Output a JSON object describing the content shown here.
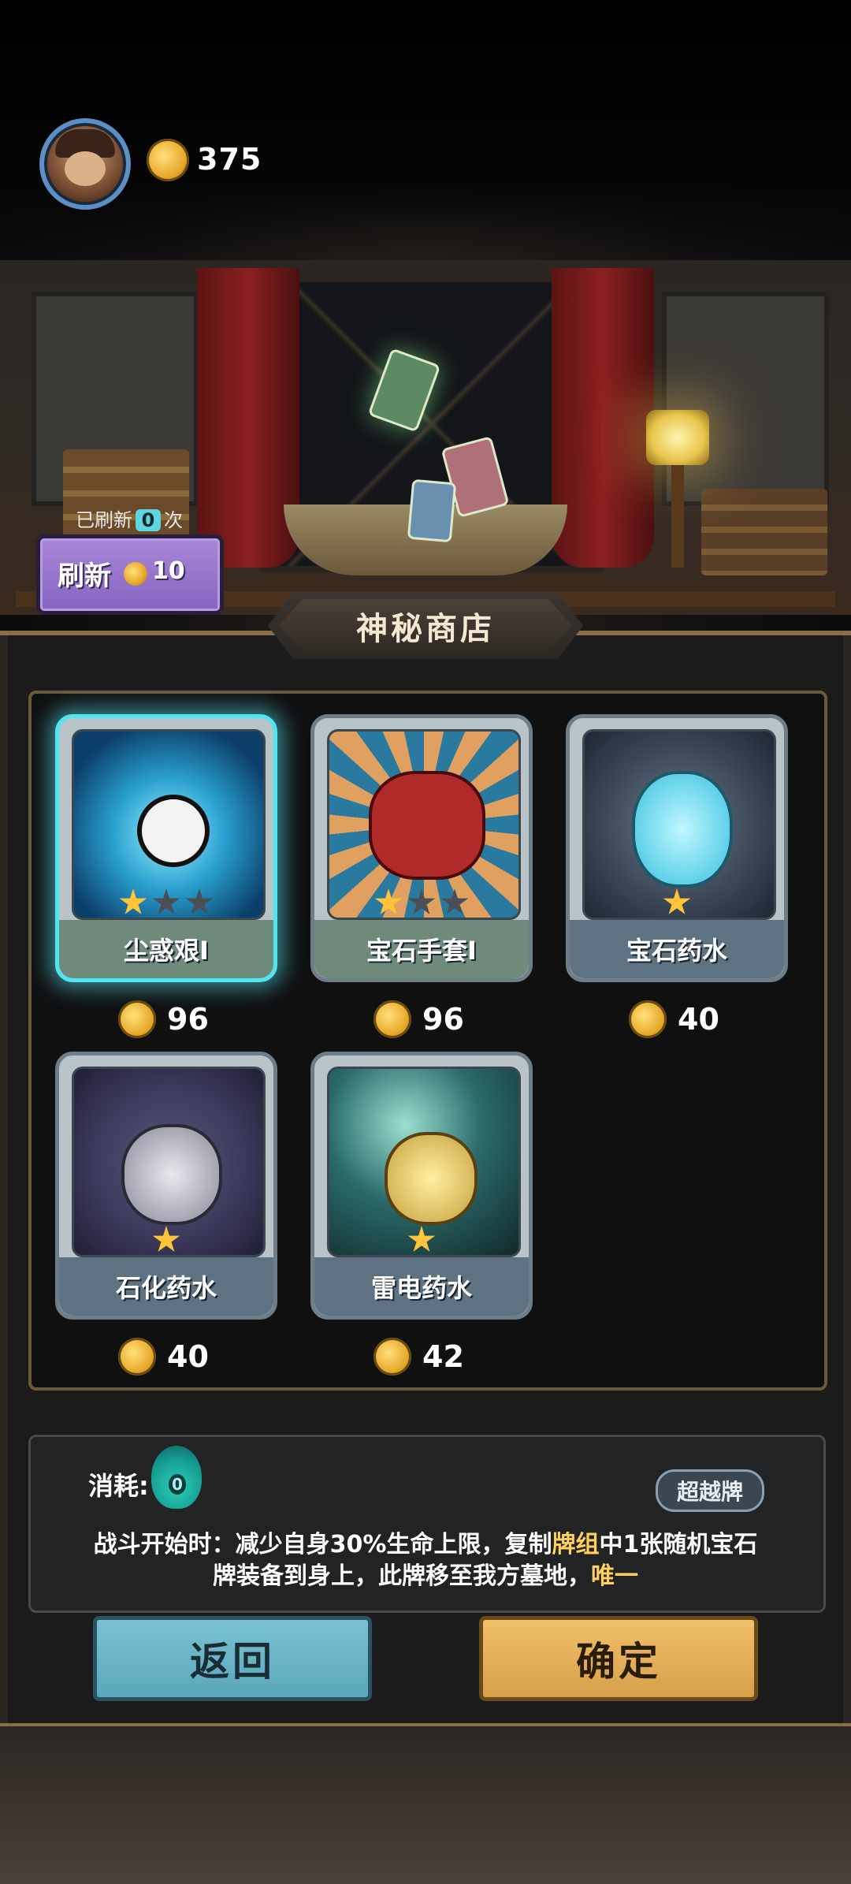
{
  "header": {
    "coins": "375"
  },
  "refresh": {
    "count_prefix": "已刷新",
    "count": "0",
    "count_suffix": "次",
    "label": "刷新",
    "cost": "10"
  },
  "shop": {
    "title": "神秘商店",
    "items": [
      {
        "name": "尘惑艰I",
        "price": "96",
        "stars_filled": 1,
        "stars_total": 3,
        "selected": true
      },
      {
        "name": "宝石手套I",
        "price": "96",
        "stars_filled": 1,
        "stars_total": 3,
        "selected": false
      },
      {
        "name": "宝石药水",
        "price": "40",
        "stars_filled": 1,
        "stars_total": 1,
        "selected": false
      },
      {
        "name": "石化药水",
        "price": "40",
        "stars_filled": 1,
        "stars_total": 1,
        "selected": false
      },
      {
        "name": "雷电药水",
        "price": "42",
        "stars_filled": 1,
        "stars_total": 1,
        "selected": false
      }
    ]
  },
  "detail": {
    "cost_label": "消耗:",
    "cost_value": "0",
    "tag": "超越牌",
    "desc_1": "战斗开始时：减少自身30%生命上限，复制",
    "desc_hl1": "牌组",
    "desc_2": "中1张随机宝石牌装备到身上，此牌移至我方墓地，",
    "desc_hl2": "唯一"
  },
  "buttons": {
    "back": "返回",
    "confirm": "确定"
  },
  "colors": {
    "highlight": "#ffd05a",
    "selected_glow": "#4ee6f0",
    "coin": "#e6a82a"
  }
}
